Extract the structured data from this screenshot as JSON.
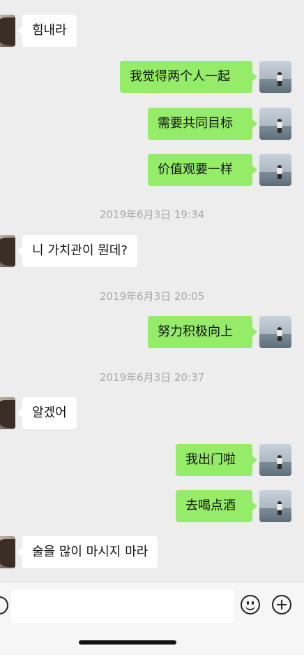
{
  "messages": [
    {
      "side": "left",
      "text": "힘내라"
    },
    {
      "side": "right",
      "text": "我觉得两个人一起"
    },
    {
      "side": "right",
      "text": "需要共同目标"
    },
    {
      "side": "right",
      "text": "价值观要一样"
    },
    {
      "time": "2019年6月3日 19:34"
    },
    {
      "side": "left",
      "text": "니 가치관이 뭔데?"
    },
    {
      "time": "2019年6月3日 20:05"
    },
    {
      "side": "right",
      "text": "努力积极向上"
    },
    {
      "time": "2019年6月3日 20:37"
    },
    {
      "side": "left",
      "text": "알겠어"
    },
    {
      "side": "right",
      "text": "我出门啦"
    },
    {
      "side": "right",
      "text": "去喝点酒"
    },
    {
      "side": "left",
      "text": "술을 많이 마시지 마라"
    }
  ],
  "input": {
    "value": "",
    "placeholder": ""
  },
  "icons": {
    "voice": "voice-icon",
    "emoji": "emoji-icon",
    "plus": "plus-icon"
  },
  "colors": {
    "sent_bubble": "#95ec69",
    "received_bubble": "#ffffff",
    "background": "#ededed"
  }
}
